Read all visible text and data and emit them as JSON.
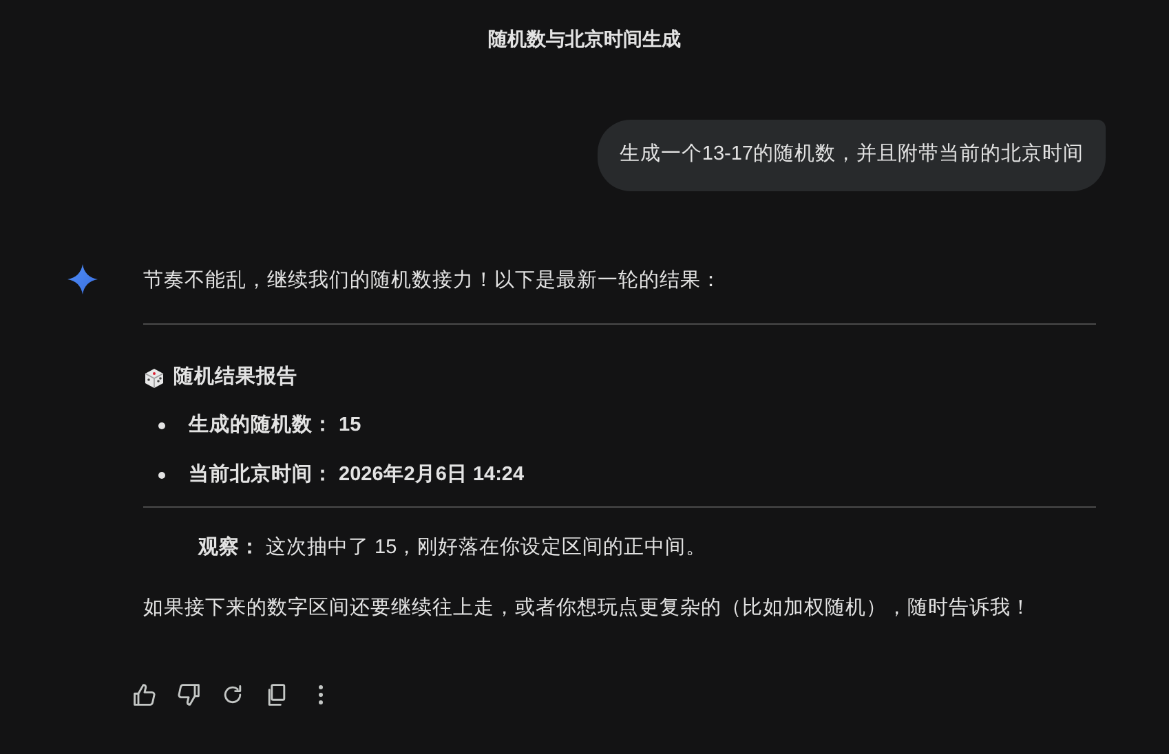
{
  "title": "随机数与北京时间生成",
  "user_message": "生成一个13-17的随机数，并且附带当前的北京时间",
  "reply": {
    "intro": "节奏不能乱，继续我们的随机数接力！以下是最新一轮的结果：",
    "heading": "随机结果报告",
    "items": [
      "生成的随机数： 15",
      "当前北京时间： 2026年2月6日 14:24"
    ],
    "note": "**观察：** 这次抽中了 15，刚好落在你设定区间的正中间。",
    "closing": "如果接下来的数字区间还要继续往上走，或者你想玩点更复杂的（比如加权随机），随时告诉我！"
  }
}
